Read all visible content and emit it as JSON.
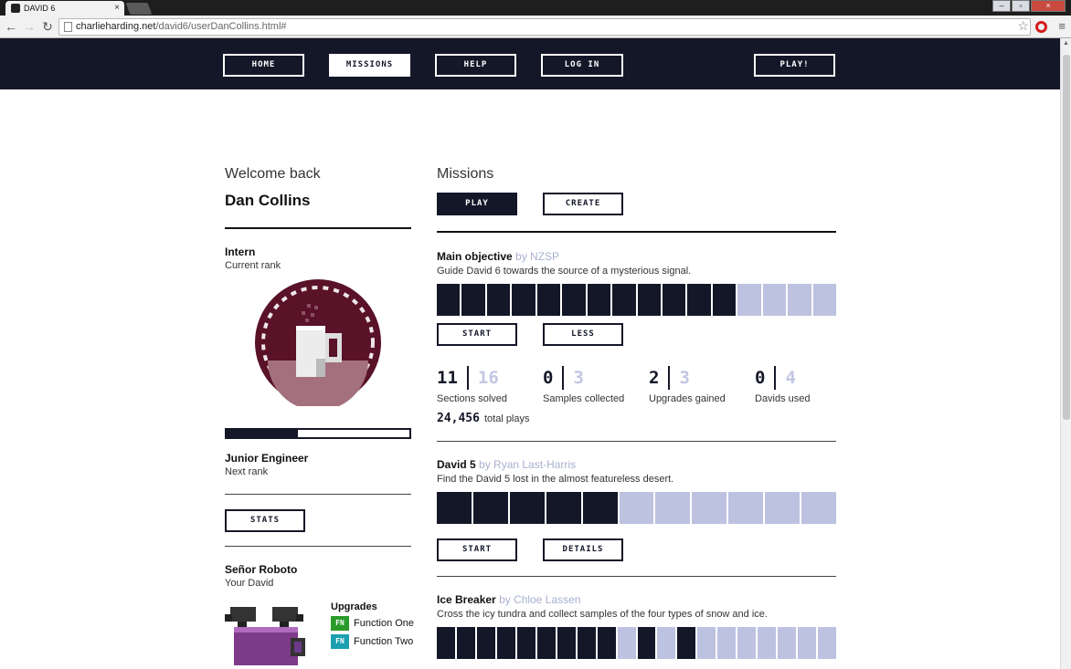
{
  "browser": {
    "tab_title": "DAVID 6",
    "url_host": "charlieharding.net",
    "url_path": "/david6/userDanCollins.html#"
  },
  "nav": {
    "home": "HOME",
    "missions": "MISSIONS",
    "help": "HELP",
    "login": "LOG IN",
    "play": "PLAY!"
  },
  "profile": {
    "welcome": "Welcome back",
    "name": "Dan Collins",
    "rank": "Intern",
    "rank_caption": "Current rank",
    "rank_progress": 0.39,
    "next_rank": "Junior Engineer",
    "next_rank_caption": "Next rank",
    "stats_button": "STATS",
    "david_name": "Señor Roboto",
    "david_caption": "Your David",
    "upgrades_title": "Upgrades",
    "upgrades": [
      {
        "badge": "FN",
        "label": "Function One",
        "color": "#2a9a2a"
      },
      {
        "badge": "FN",
        "label": "Function Two",
        "color": "#1aa0b0"
      }
    ]
  },
  "missions": {
    "title": "Missions",
    "play_button": "PLAY",
    "create_button": "CREATE",
    "list": [
      {
        "name": "Main objective",
        "author": "by NZSP",
        "description": "Guide David 6 towards the source of a mysterious signal.",
        "segments_total": 16,
        "segments_done": 12,
        "btn1": "START",
        "btn2": "LESS"
      },
      {
        "name": "David 5",
        "author": "by Ryan Last-Harris",
        "description": "Find the David 5 lost in the almost featureless desert.",
        "segments_total": 11,
        "segments_done": 5,
        "btn1": "START",
        "btn2": "DETAILS"
      },
      {
        "name": "Ice Breaker",
        "author": "by Chloe Lassen",
        "description": "Cross the icy tundra and collect samples of the four types of snow and ice.",
        "segments_total": 20,
        "segments_pattern": [
          1,
          1,
          1,
          1,
          1,
          1,
          1,
          1,
          1,
          0,
          1,
          0,
          1,
          0,
          0,
          0,
          0,
          0,
          0,
          0
        ]
      }
    ],
    "stats": [
      {
        "value": "11",
        "total": "16",
        "label": "Sections solved"
      },
      {
        "value": "0",
        "total": "3",
        "label": "Samples collected"
      },
      {
        "value": "2",
        "total": "3",
        "label": "Upgrades gained"
      },
      {
        "value": "0",
        "total": "4",
        "label": "Davids used"
      }
    ],
    "plays_value": "24,456",
    "plays_label": "total plays"
  },
  "colors": {
    "navy": "#141728",
    "segment_off": "#bcc2e0",
    "badge_maroon": "#5a1228"
  }
}
